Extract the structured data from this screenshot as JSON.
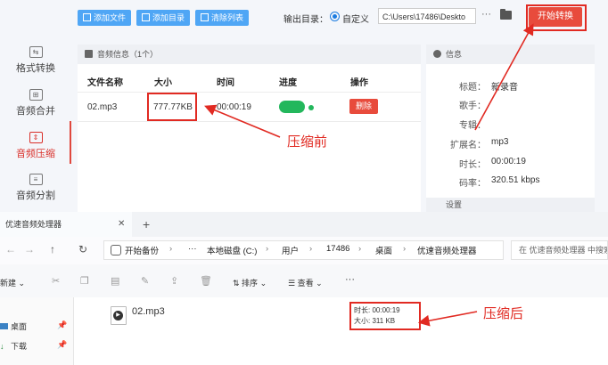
{
  "sidebar": {
    "items": [
      {
        "label": "格式转换",
        "icon": "format-convert-icon"
      },
      {
        "label": "音频合并",
        "icon": "audio-merge-icon"
      },
      {
        "label": "音频压缩",
        "icon": "audio-compress-icon",
        "active": true
      },
      {
        "label": "音频分割",
        "icon": "audio-split-icon"
      }
    ]
  },
  "toolbar": {
    "add_file": "添加文件",
    "add_dir": "添加目录",
    "clear_list": "清除列表",
    "output_label": "输出目录：",
    "output_mode": "自定义",
    "output_path": "C:\\Users\\17486\\Deskto",
    "more": "···",
    "start": "开始转换"
  },
  "file_panel": {
    "header": "音频信息（1个）",
    "columns": [
      "文件名称",
      "大小",
      "时间",
      "进度",
      "操作"
    ],
    "rows": [
      {
        "name": "02.mp3",
        "size": "777.77KB",
        "time": "00:00:19",
        "action": "删除"
      }
    ]
  },
  "info_panel": {
    "header": "信息",
    "fields": [
      {
        "key": "标题：",
        "value": "新录音"
      },
      {
        "key": "歌手：",
        "value": ""
      },
      {
        "key": "专辑：",
        "value": ""
      },
      {
        "key": "扩展名：",
        "value": "mp3"
      },
      {
        "key": "时长：",
        "value": "00:00:19"
      },
      {
        "key": "码率：",
        "value": "320.51 kbps"
      }
    ],
    "settings_header": "设置"
  },
  "annotations": {
    "before": "压缩前",
    "after": "压缩后",
    "color": "#e12a22"
  },
  "explorer": {
    "tab_title": "优速音频处理器",
    "new_tab": "+",
    "breadcrumb": [
      "开始备份",
      "···",
      "本地磁盘 (C:)",
      "用户",
      "17486",
      "桌面",
      "优速音频处理器"
    ],
    "search_placeholder": "在 优速音频处理器 中搜索",
    "commands": {
      "new": "新建",
      "sort": "排序",
      "view": "查看",
      "more": "···"
    },
    "nav_items": [
      "桌面",
      "下载"
    ],
    "file": {
      "name": "02.mp3",
      "duration_label": "时长:",
      "duration": "00:00:19",
      "size_label": "大小:",
      "size": "311 KB"
    }
  },
  "colors": {
    "accent_red": "#e84b3c",
    "toolbar_blue": "#4fa6f5",
    "progress_green": "#23b75c"
  }
}
